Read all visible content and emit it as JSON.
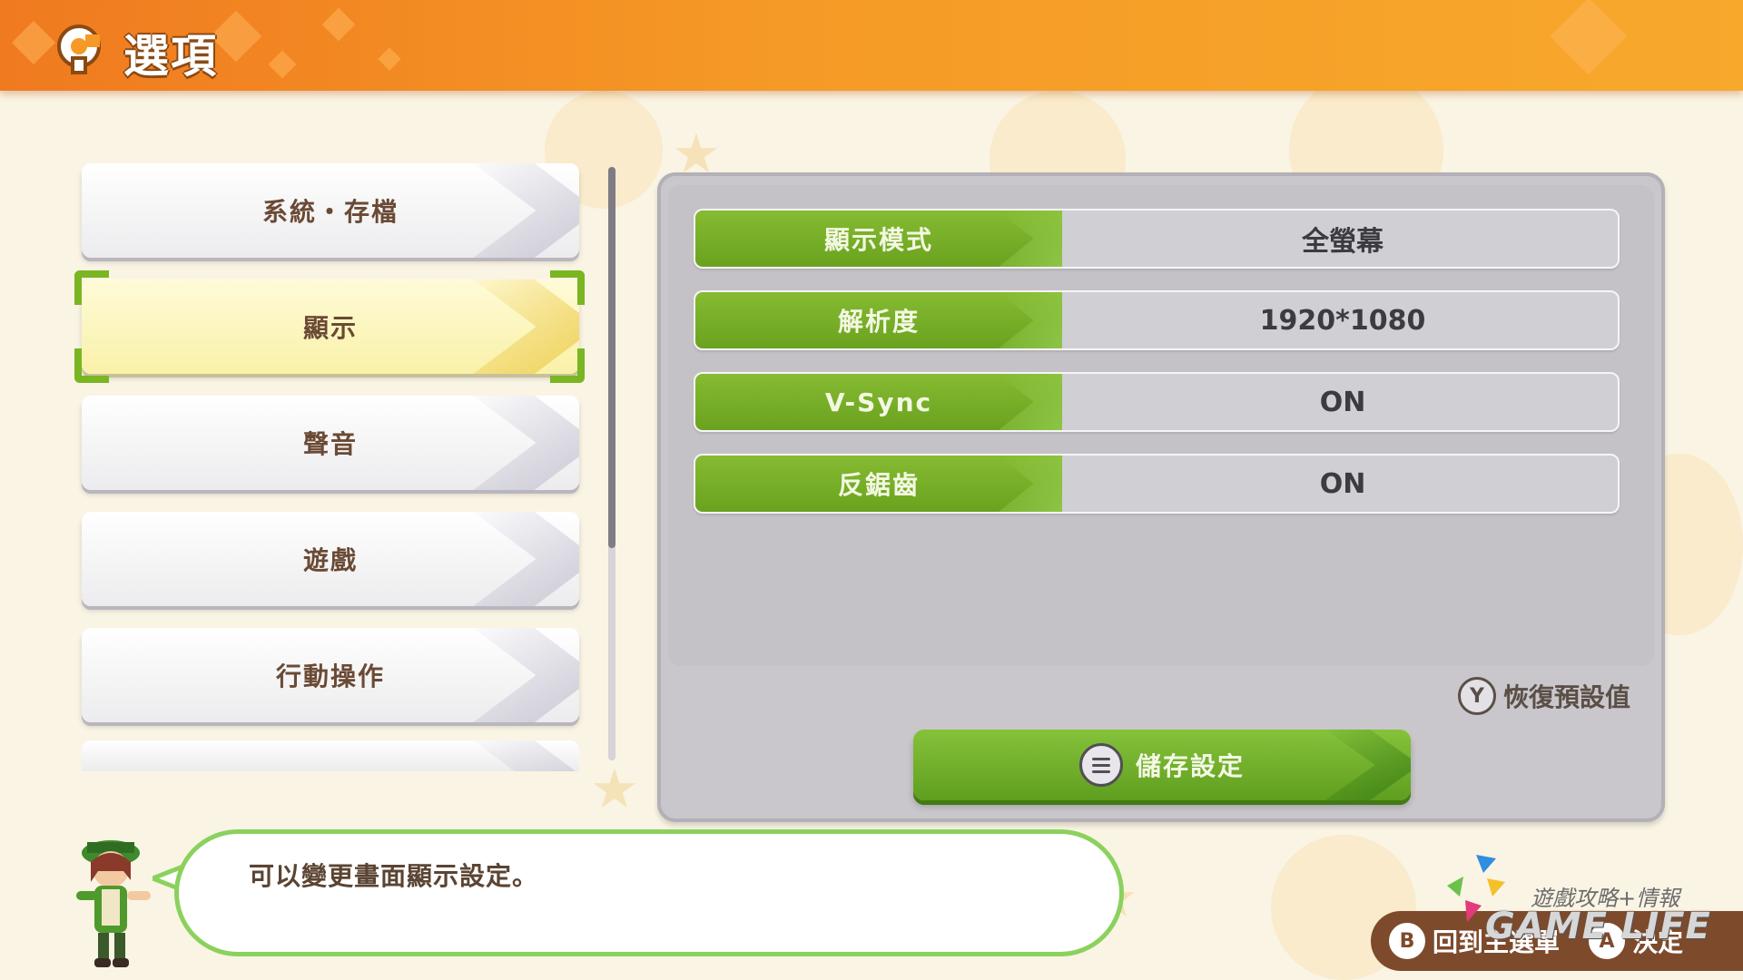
{
  "header": {
    "title": "選項"
  },
  "menu": {
    "items": [
      {
        "label": "系統・存檔"
      },
      {
        "label": "顯示",
        "selected": true
      },
      {
        "label": "聲音"
      },
      {
        "label": "遊戲"
      },
      {
        "label": "行動操作"
      }
    ]
  },
  "settings": {
    "rows": [
      {
        "name": "顯示模式",
        "value": "全螢幕"
      },
      {
        "name": "解析度",
        "value": "1920*1080"
      },
      {
        "name": "V-Sync",
        "value": "ON"
      },
      {
        "name": "反鋸齒",
        "value": "ON"
      }
    ],
    "restore": {
      "button": "Y",
      "label": "恢復預設值"
    },
    "save": {
      "label": "儲存設定"
    }
  },
  "dialog": {
    "text": "可以變更畫面顯示設定。"
  },
  "footer": {
    "back": {
      "button": "B",
      "label": "回到主選單"
    },
    "confirm": {
      "button": "A",
      "label": "決定"
    }
  },
  "watermark": {
    "sub": "遊戲攻略+情報",
    "main": "GAME LIFE"
  },
  "colors": {
    "header": "#f59a26",
    "accent_green": "#6aa21f",
    "selected_bg": "#f9f1a8",
    "bubble_border": "#8bd15d",
    "text_brown": "#6a4a35"
  }
}
